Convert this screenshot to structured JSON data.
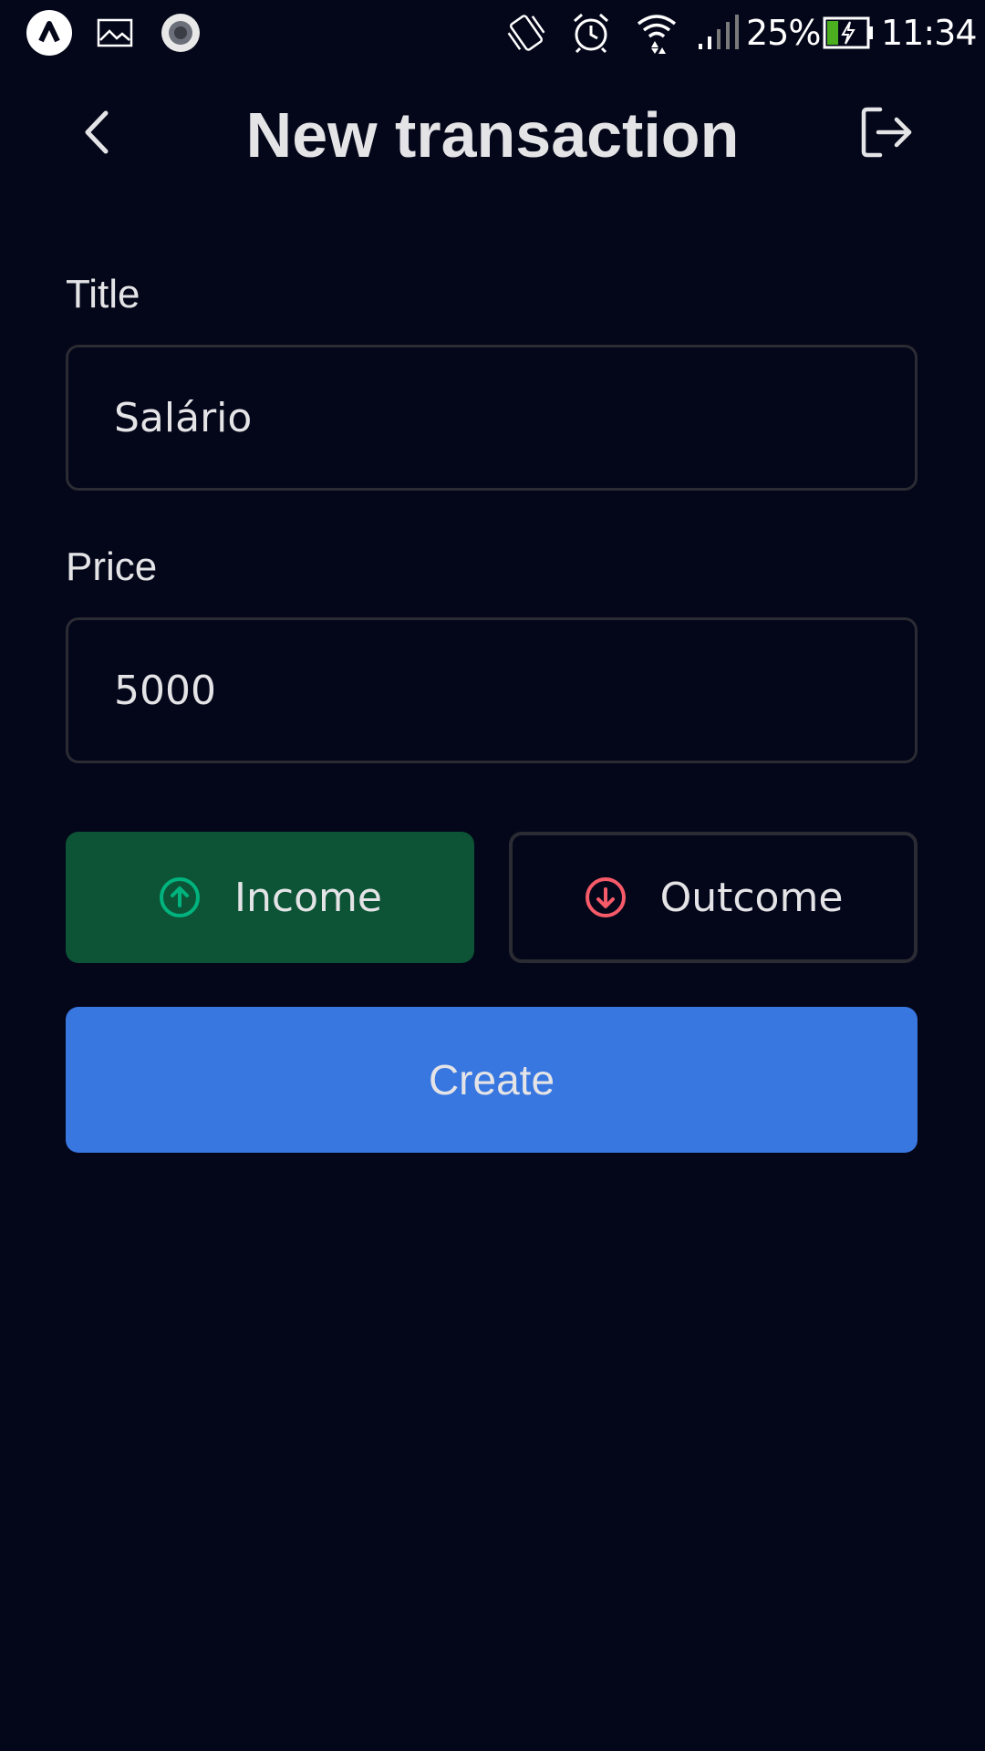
{
  "status_bar": {
    "battery_percent": "25%",
    "time": "11:34",
    "icons": [
      "app-launcher-icon",
      "gallery-icon",
      "record-icon",
      "vibrate-icon",
      "alarm-icon",
      "wifi-icon",
      "signal-icon",
      "battery-charging-icon"
    ]
  },
  "header": {
    "title": "New transaction",
    "back_icon": "chevron-left-icon",
    "logout_icon": "logout-icon"
  },
  "form": {
    "title_label": "Title",
    "title_value": "Salário",
    "price_label": "Price",
    "price_value": "5000",
    "income_label": "Income",
    "outcome_label": "Outcome",
    "create_label": "Create"
  },
  "colors": {
    "background": "#04071a",
    "income_selected_bg": "#0c5435",
    "income_icon": "#00b37e",
    "outcome_icon": "#f75a68",
    "create_button": "#3876e0"
  }
}
